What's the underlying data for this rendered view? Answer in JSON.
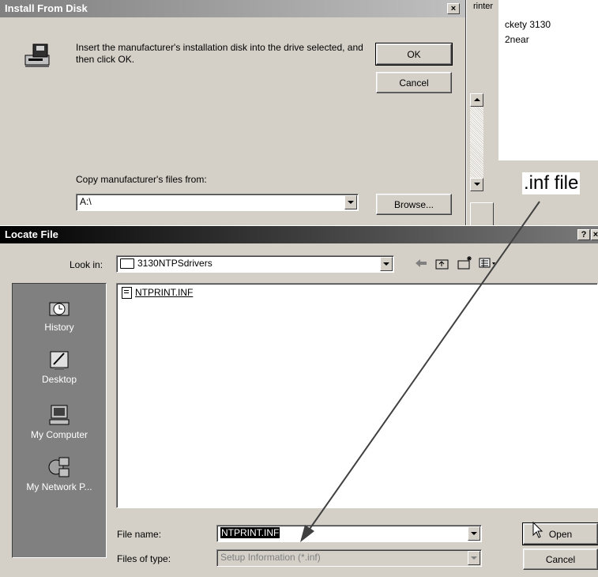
{
  "background_window": {
    "printer_partial": "rinter",
    "list_item_1": "ckety 3130",
    "list_item_2": "2near"
  },
  "install_dialog": {
    "title": "Install From Disk",
    "close": "×",
    "message": "Insert the manufacturer's installation disk into the drive selected, and then click OK.",
    "ok_label": "OK",
    "cancel_label": "Cancel",
    "copy_label": "Copy manufacturer's files from:",
    "path_value": "A:\\",
    "browse_label": "Browse..."
  },
  "annotation": {
    "text": ".inf file"
  },
  "locate_dialog": {
    "title": "Locate File",
    "help": "?",
    "close": "×",
    "look_in_label": "Look in:",
    "look_in_value": "3130NTPSdrivers",
    "places": [
      {
        "label": "History",
        "icon": "history-icon"
      },
      {
        "label": "Desktop",
        "icon": "desktop-icon"
      },
      {
        "label": "My Computer",
        "icon": "my-computer-icon"
      },
      {
        "label": "My Network P...",
        "icon": "network-places-icon"
      }
    ],
    "files": [
      {
        "name": "NTPRINT.INF"
      }
    ],
    "file_name_label": "File name:",
    "file_name_value": "NTPRINT.INF",
    "files_of_type_label": "Files of type:",
    "files_of_type_value": "Setup Information (*.inf)",
    "open_label": "Open",
    "cancel_label": "Cancel"
  },
  "colors": {
    "dialog_face": "#d4d0c8",
    "title_inactive": "#808080",
    "selection": "#000000",
    "places_bar": "#808080"
  }
}
